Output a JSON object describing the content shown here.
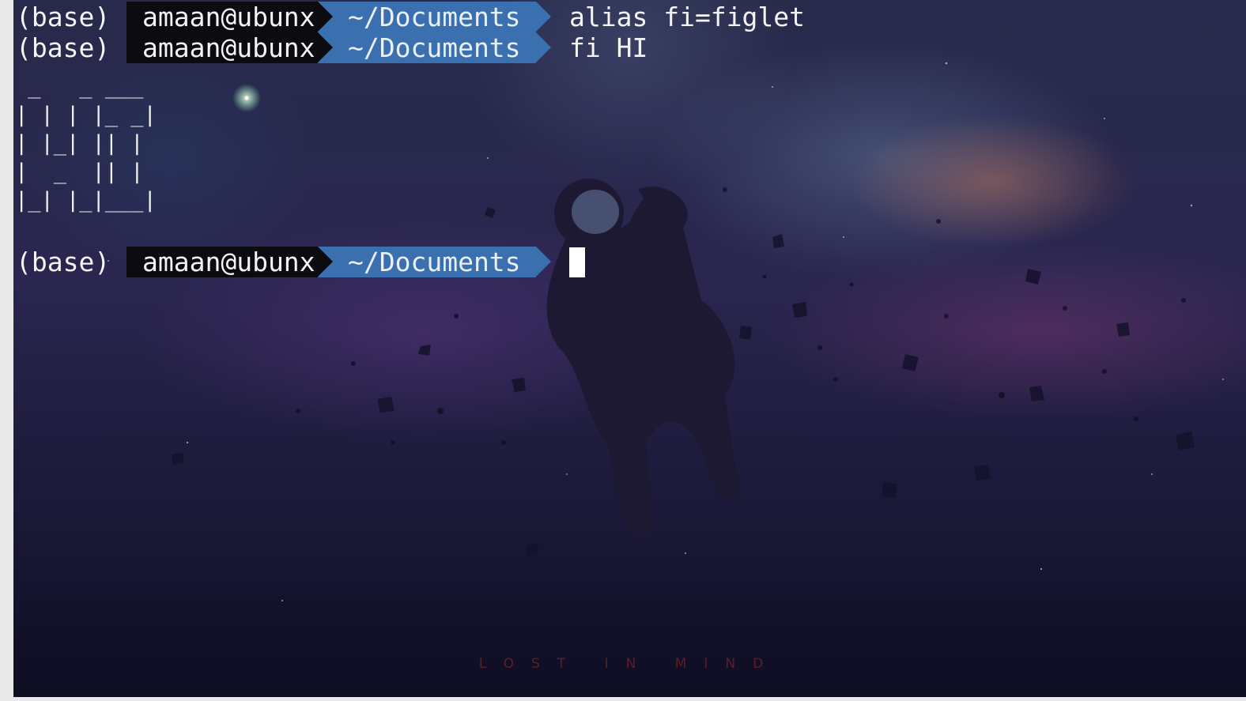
{
  "terminal": {
    "lines": [
      {
        "env": "(base)",
        "user": "amaan@ubunx",
        "dir": "~/Documents",
        "command": "alias fi=figlet"
      },
      {
        "env": "(base)",
        "user": "amaan@ubunx",
        "dir": "~/Documents",
        "command": "fi HI"
      }
    ],
    "figlet_output": " _   _ ___ \n| | | |_ _|\n| |_| || | \n|  _  || | \n|_| |_|___|",
    "prompt": {
      "env": "(base)",
      "user": "amaan@ubunx",
      "dir": "~/Documents"
    }
  },
  "wallpaper": {
    "caption": "LOST IN MIND",
    "subject": "astronaut-floating-in-space"
  },
  "colors": {
    "user_segment_bg": "#0b0b10",
    "dir_segment_bg": "#3a6fb0",
    "text": "#f4f4f4",
    "cursor": "#ffffff"
  }
}
